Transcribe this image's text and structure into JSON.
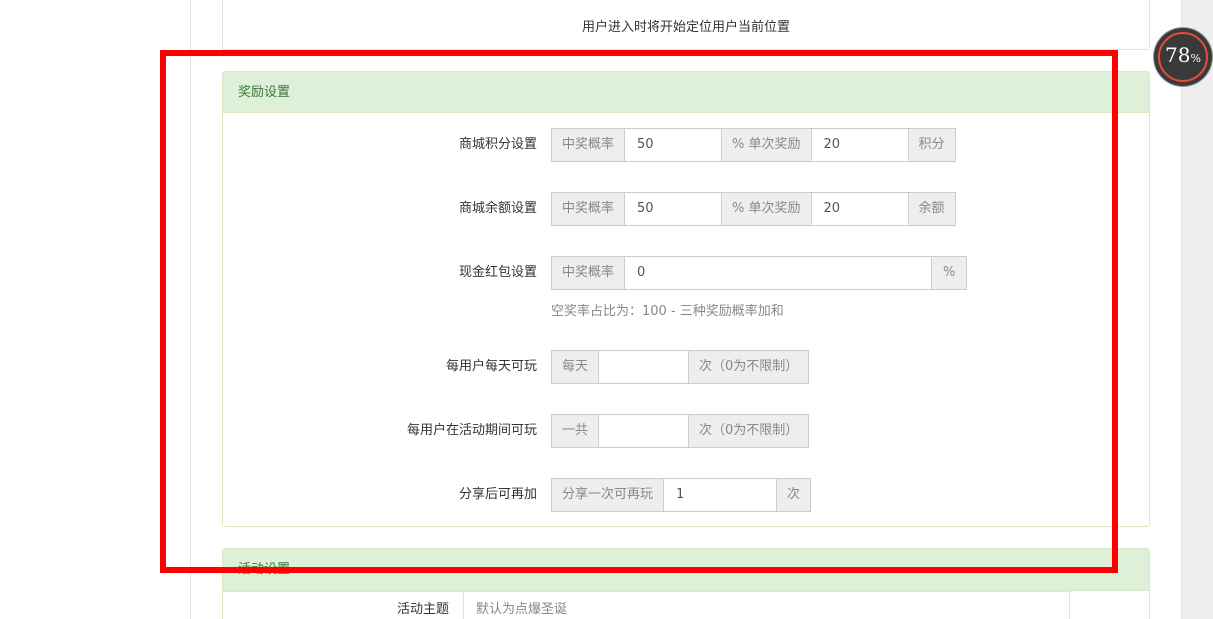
{
  "top_panel": {
    "note": "用户进入时将开始定位用户当前位置"
  },
  "reward_panel": {
    "title": "奖励设置",
    "rows": [
      {
        "label": "商城积分设置",
        "prob_addon": "中奖概率",
        "prob_value": "50",
        "mid_addon": "% 单次奖励",
        "amount_value": "20",
        "unit_addon": "积分"
      },
      {
        "label": "商城余额设置",
        "prob_addon": "中奖概率",
        "prob_value": "50",
        "mid_addon": "% 单次奖励",
        "amount_value": "20",
        "unit_addon": "余额"
      },
      {
        "label": "现金红包设置",
        "prob_addon": "中奖概率",
        "prob_value": "0",
        "unit_addon": "%",
        "hint": "空奖率占比为：100 - 三种奖励概率加和"
      },
      {
        "label": "每用户每天可玩",
        "prefix_addon": "每天",
        "value": "",
        "suffix_addon": "次（0为不限制）"
      },
      {
        "label": "每用户在活动期间可玩",
        "prefix_addon": "一共",
        "value": "",
        "suffix_addon": "次（0为不限制）"
      },
      {
        "label": "分享后可再加",
        "prefix_addon": "分享一次可再玩",
        "value": "1",
        "suffix_addon": "次"
      }
    ]
  },
  "activity_panel": {
    "title": "活动设置",
    "theme_label": "活动主题",
    "theme_placeholder": "默认为点爆圣诞"
  },
  "progress_bubble": {
    "value": "78",
    "unit": "%"
  },
  "colors": {
    "highlight": "#ff0000",
    "panel_heading_bg": "#dff0d8",
    "panel_heading_text": "#3c763d",
    "bubble_ring": "#e74c3c"
  }
}
